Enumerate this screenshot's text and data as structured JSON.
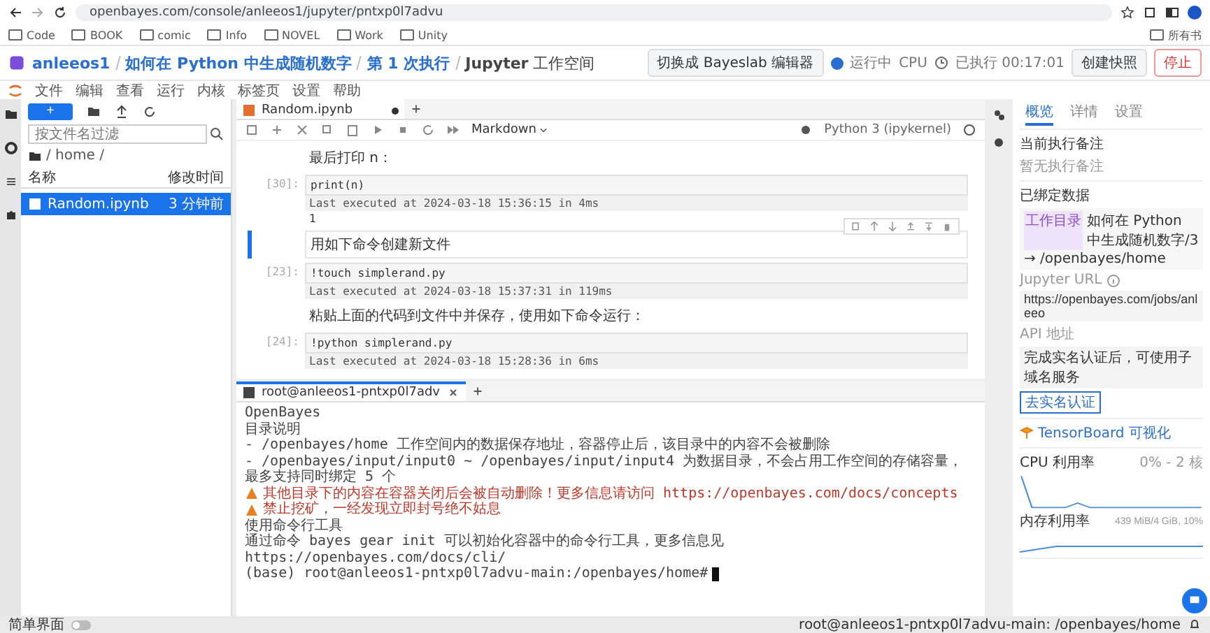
{
  "browser": {
    "url": "openbayes.com/console/anleeos1/jupyter/pntxp0l7advu",
    "bookmarks": [
      "Code",
      "BOOK",
      "comic",
      "Info",
      "NOVEL",
      "Work",
      "Unity"
    ],
    "all_bookmarks": "所有书"
  },
  "header": {
    "user": "anleeos1",
    "breadcrumb": [
      "如何在 Python 中生成随机数字",
      "第 1 次执行"
    ],
    "app": "Jupyter",
    "app_suffix": "工作空间",
    "switch_button": "切换成 Bayeslab 编辑器",
    "status": "运行中",
    "running": true,
    "cpu": "CPU",
    "elapsed": "已执行 00:17:01",
    "snapshot_button": "创建快照",
    "stop_button": "停止"
  },
  "menu": [
    "文件",
    "编辑",
    "查看",
    "运行",
    "内核",
    "标签页",
    "设置",
    "帮助"
  ],
  "file_browser": {
    "new_button": "+",
    "filter_placeholder": "按文件名过滤",
    "path": "/ home /",
    "columns": [
      "名称",
      "修改时间"
    ],
    "rows": [
      {
        "name": "Random.ipynb",
        "modified": "3 分钟前",
        "selected": true
      }
    ]
  },
  "notebook": {
    "tab": "Random.ipynb",
    "modified": true,
    "cell_type": "Markdown",
    "kernel": "Python 3 (ipykernel)",
    "cells": [
      {
        "kind": "markdown",
        "text": "最后打印 n：",
        "active": false
      },
      {
        "kind": "code",
        "prompt": "[30]:",
        "code": "print(n)",
        "executed": "Last executed at 2024-03-18 15:36:15 in 4ms",
        "output": "1",
        "active": false
      },
      {
        "kind": "markdown",
        "text": "用如下命令创建新文件",
        "active": true
      },
      {
        "kind": "code",
        "prompt": "[23]:",
        "code": "!touch simplerand.py",
        "executed": "Last executed at 2024-03-18 15:37:31 in 119ms",
        "active": false
      },
      {
        "kind": "markdown",
        "text": "粘贴上面的代码到文件中并保存，使用如下命令运行：",
        "active": false
      },
      {
        "kind": "code",
        "prompt": "[24]:",
        "code": "!python simplerand.py",
        "executed": "Last executed at 2024-03-18 15:28:36 in 6ms",
        "active": false
      }
    ]
  },
  "terminal": {
    "tab": "root@anleeos1-pntxp0l7adv",
    "lines": [
      {
        "kind": "plain",
        "text": "OpenBayes"
      },
      {
        "kind": "plain",
        "text": "目录说明"
      },
      {
        "kind": "plain",
        "text": "- /openbayes/home 工作空间内的数据保存地址，容器停止后，该目录中的内容不会被删除"
      },
      {
        "kind": "plain",
        "text": "- /openbayes/input/input0 ~ /openbayes/input/input4 为数据目录，不会占用工作空间的存储容量，最多支持同时绑定 5 个"
      },
      {
        "kind": "warning",
        "text": "其他目录下的内容在容器关闭后会被自动删除！更多信息请访问 https://openbayes.com/docs/concepts"
      },
      {
        "kind": "warning",
        "text": "禁止挖矿，一经发现立即封号绝不姑息"
      },
      {
        "kind": "plain",
        "text": "使用命令行工具"
      },
      {
        "kind": "plain",
        "text": "通过命令 bayes gear init 可以初始化容器中的命令行工具，更多信息见 https://openbayes.com/docs/cli/"
      },
      {
        "kind": "prompt",
        "text": "(base) root@anleeos1-pntxp0l7advu-main:/openbayes/home#"
      }
    ]
  },
  "side_panel": {
    "tabs": [
      {
        "label": "概览",
        "selected": true
      },
      {
        "label": "详情",
        "selected": false
      },
      {
        "label": "设置",
        "selected": false
      }
    ],
    "note_title": "当前执行备注",
    "note": "暂无执行备注",
    "bound_title": "已绑定数据",
    "bound_tag": "工作目录",
    "bound_name": "如何在 Python 中生成随机数字/3",
    "bound_path": "→ /openbayes/home",
    "url_label": "Jupyter URL",
    "url": "https://openbayes.com/jobs/anleeo",
    "api_label": "API 地址",
    "api_note": "完成实名认证后，可使用子域名服务",
    "verify_button": "去实名认证",
    "tensorboard": "TensorBoard 可视化",
    "cpu_title": "CPU 利用率",
    "cpu_range": "0% - 2 核",
    "mem_title": "内存利用率",
    "mem_range": "439 MiB/4 GiB, 10%"
  },
  "status_bar": {
    "simple_mode": "简单界面",
    "simple_on": false,
    "path": "root@anleeos1-pntxp0l7advu-main: /openbayes/home"
  }
}
